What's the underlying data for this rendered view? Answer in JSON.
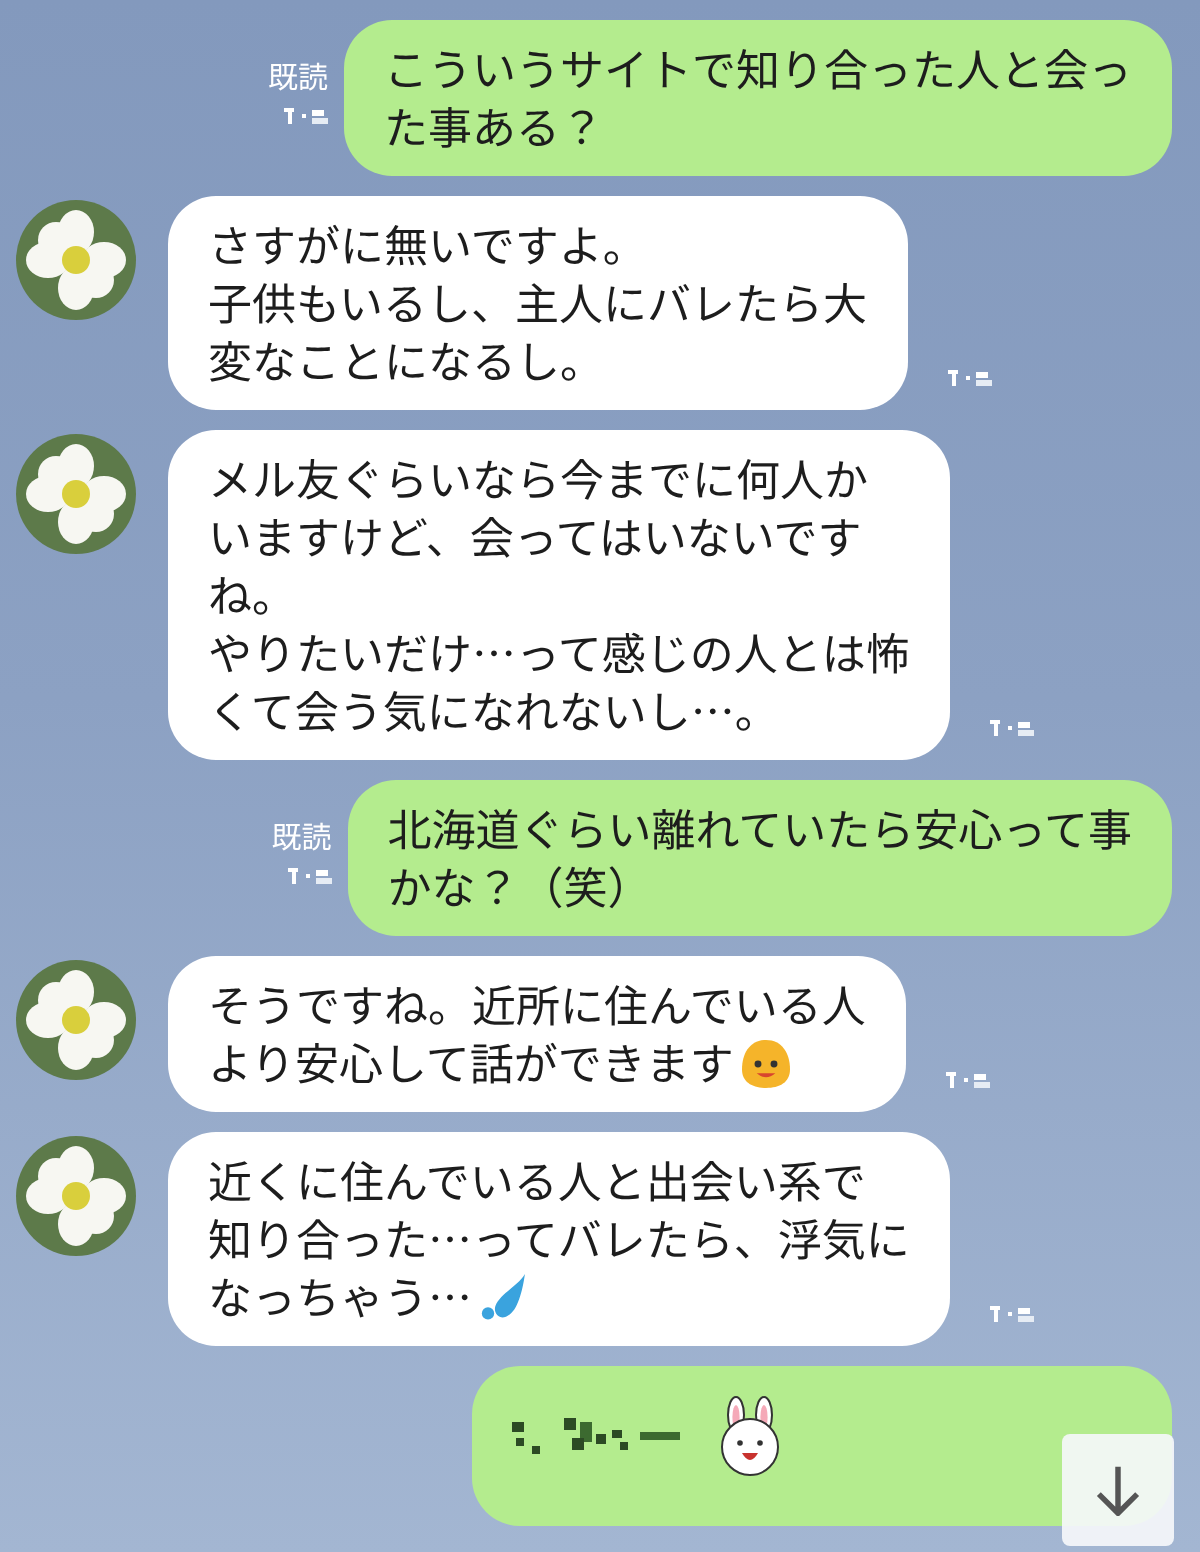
{
  "messages": [
    {
      "kind": "sent",
      "lines": [
        "こういうサイトで知り合った人と会っ",
        "た事ある？"
      ],
      "read_label": "既読"
    },
    {
      "kind": "received",
      "lines": [
        "さすがに無いですよ。",
        "子供もいるし、主人にバレたら大",
        "変なことになるし。"
      ]
    },
    {
      "kind": "received",
      "lines": [
        "メル友ぐらいなら今までに何人か",
        "いますけど、会ってはいないです",
        "ね。",
        "やりたいだけ…って感じの人とは怖",
        "くて会う気になれないし…。"
      ]
    },
    {
      "kind": "sent",
      "lines": [
        "北海道ぐらい離れていたら安心って事",
        "かな？（笑）"
      ],
      "read_label": "既読"
    },
    {
      "kind": "received_smiley",
      "lines": [
        "そうですね。近所に住んでいる人",
        "より安心して話ができます"
      ]
    },
    {
      "kind": "received_drop",
      "lines": [
        "近くに住んでいる人と出会い系で",
        "知り合った…ってバレたら、浮気に",
        "なっちゃう…"
      ]
    },
    {
      "kind": "sticker_hidden"
    }
  ]
}
